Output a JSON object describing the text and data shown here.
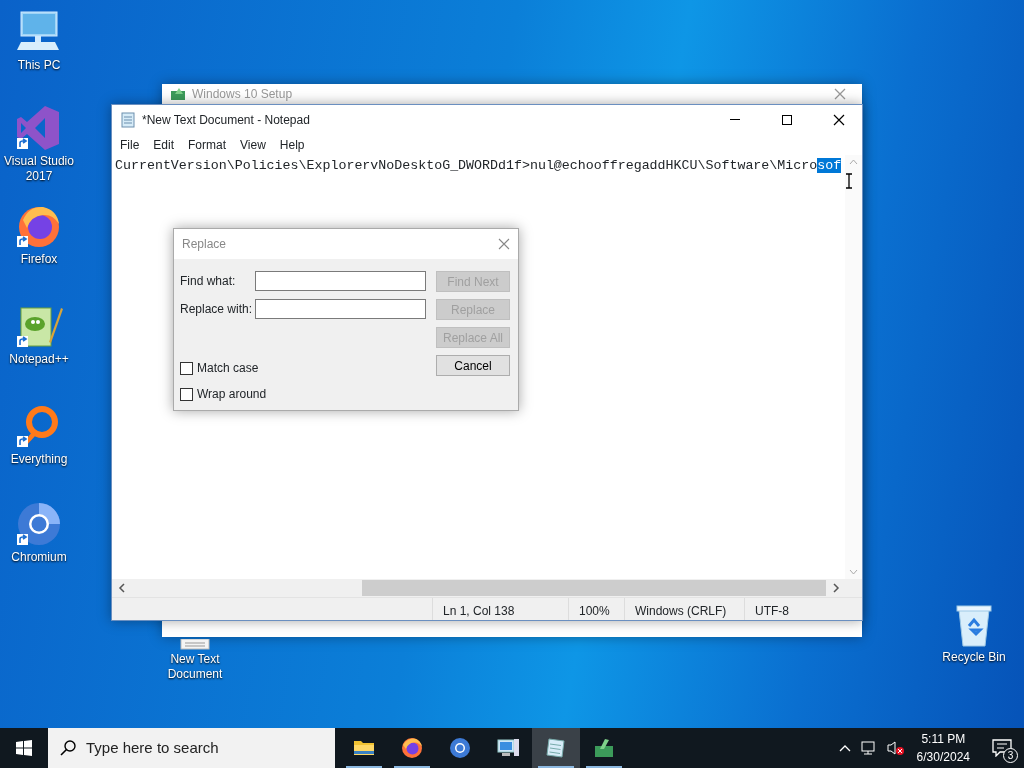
{
  "desktop_icons": [
    {
      "label": "This PC",
      "kind": "pc",
      "shortcut": false
    },
    {
      "label": "Visual Studio 2017",
      "kind": "vs",
      "shortcut": true
    },
    {
      "label": "Firefox",
      "kind": "firefox",
      "shortcut": true
    },
    {
      "label": "Notepad++",
      "kind": "notepadpp",
      "shortcut": true
    },
    {
      "label": "Everything",
      "kind": "everything",
      "shortcut": true
    },
    {
      "label": "Chromium",
      "kind": "chromium",
      "shortcut": true
    },
    {
      "label": "New Text Document",
      "kind": "textfile"
    },
    {
      "label": "Recycle Bin",
      "kind": "recycle",
      "shortcut": false
    }
  ],
  "background_window": {
    "title": "Windows 10 Setup"
  },
  "notepad": {
    "title": "*New Text Document - Notepad",
    "menu": [
      "File",
      "Edit",
      "Format",
      "View",
      "Help"
    ],
    "text": "CurrentVersion\\Policies\\ExplorervNoDesktoG_DWORDd1f>nul@echooffregaddHKCU\\Software\\Micro",
    "selected_text": "sof",
    "status": [
      "Ln 1, Col 138",
      "100%",
      "Windows (CRLF)",
      "UTF-8"
    ]
  },
  "replace_dialog": {
    "title": "Replace",
    "fields": [
      {
        "label": "Find what:"
      },
      {
        "label": "Replace with:"
      }
    ],
    "buttons": [
      {
        "label": "Find Next",
        "disabled": true
      },
      {
        "label": "Replace",
        "disabled": true
      },
      {
        "label": "Replace All",
        "disabled": true
      },
      {
        "label": "Cancel",
        "disabled": false
      }
    ],
    "checkboxes": [
      {
        "label": "Match case",
        "checked": false
      },
      {
        "label": "Wrap around",
        "checked": false
      }
    ]
  },
  "taskbar": {
    "search": {
      "placeholder": "Type here to search"
    },
    "apps": [
      {
        "kind": "files",
        "running": true,
        "selected": false
      },
      {
        "kind": "firefox",
        "running": true,
        "selected": false
      },
      {
        "kind": "chromium",
        "running": false,
        "selected": false
      },
      {
        "kind": "computer",
        "running": false,
        "selected": false
      },
      {
        "kind": "notepad",
        "running": true,
        "selected": true
      },
      {
        "kind": "setup",
        "running": true,
        "selected": false
      }
    ],
    "time": "5:11 PM",
    "date": "6/30/2024",
    "notifications": "3"
  }
}
